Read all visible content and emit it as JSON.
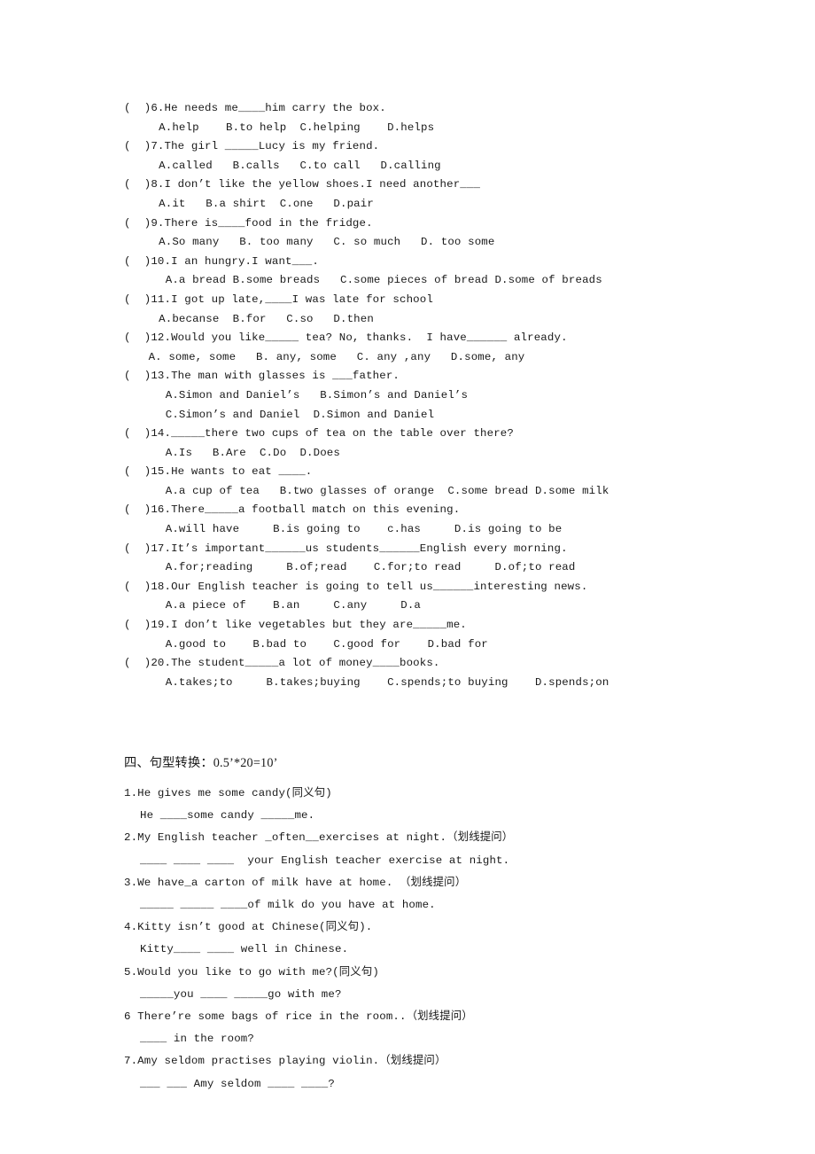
{
  "document": {
    "title": "English Grammar Worksheet",
    "background_color": "#ffffff",
    "text_color": "#191919"
  },
  "multiple_choice": {
    "questions": [
      {
        "stem": "(  )6.He needs me____him carry the box.",
        "options": "  A.help    B.to help  C.helping    D.helps",
        "options_indent": "opt"
      },
      {
        "stem": "(  )7.The girl _____Lucy is my friend.",
        "options": "  A.called   B.calls   C.to call   D.calling",
        "options_indent": "opt"
      },
      {
        "stem": "(  )8.I don’t like the yellow shoes.I need another___",
        "options": "  A.it   B.a shirt  C.one   D.pair",
        "options_indent": "opt"
      },
      {
        "stem": "(  )9.There is____food in the fridge.",
        "options": "  A.So many   B. too many   C. so much   D. too some",
        "options_indent": "opt"
      },
      {
        "stem": "(  )10.I an hungry.I want___.",
        "options": "   A.a bread B.some breads   C.some pieces of bread D.some of breads",
        "options_indent": "opt"
      },
      {
        "stem": "(  )11.I got up late,____I was late for school",
        "options": "  A.becanse  B.for   C.so   D.then",
        "options_indent": "opt"
      },
      {
        "stem": "(  )12.Would you like_____ tea? No, thanks.  I have______ already.",
        "options": " A. some, some   B. any, some   C. any ,any   D.some, any",
        "options_indent": "opt-tight"
      },
      {
        "stem": "(  )13.The man with glasses is ___father.",
        "options": "   A.Simon and Daniel’s   B.Simon’s and Daniel’s",
        "options_indent": "opt",
        "options2": "   C.Simon’s and Daniel  D.Simon and Daniel"
      },
      {
        "stem": "(  )14._____there two cups of tea on the table over there?",
        "options": "   A.Is   B.Are  C.Do  D.Does",
        "options_indent": "opt"
      },
      {
        "stem": "(  )15.He wants to eat ____.",
        "options": "   A.a cup of tea   B.two glasses of orange  C.some bread D.some milk",
        "options_indent": "opt"
      },
      {
        "stem": "(  )16.There_____a football match on this evening.",
        "options": "   A.will have     B.is going to    c.has     D.is going to be",
        "options_indent": "opt"
      },
      {
        "stem": "(  )17.It’s important______us students______English every morning.",
        "options": "   A.for;reading     B.of;read    C.for;to read     D.of;to read",
        "options_indent": "opt"
      },
      {
        "stem": "(  )18.Our English teacher is going to tell us______interesting news.",
        "options": "   A.a piece of    B.an     C.any     D.a",
        "options_indent": "opt"
      },
      {
        "stem": "(  )19.I don’t like vegetables but they are_____me.",
        "options": "   A.good to    B.bad to    C.good for    D.bad for",
        "options_indent": "opt"
      },
      {
        "stem": "(  )20.The student_____a lot of money____books.",
        "options": "   A.takes;to     B.takes;buying    C.spends;to buying    D.spends;on",
        "options_indent": "opt"
      }
    ]
  },
  "section_four": {
    "heading": "四、句型转换：0.5’*20=10’",
    "items": [
      {
        "stem": "1.He gives me some candy(同义句)",
        "answer": "He ____some candy _____me."
      },
      {
        "stem": "2.My English teacher _often__exercises at night.（划线提问）",
        "answer": "____ ____ ____  your English teacher exercise at night."
      },
      {
        "stem": "3.We have_a carton of milk have at home. （划线提问）",
        "answer": "_____ _____ ____of milk do you have at home."
      },
      {
        "stem": "4.Kitty isn’t good at Chinese(同义句).",
        "answer": "Kitty____ ____ well in Chinese."
      },
      {
        "stem": "5.Would you like to go with me?(同义句)",
        "answer": "_____you ____ _____go with me?"
      },
      {
        "stem": "6 There’re some bags of rice in the room..（划线提问）",
        "answer": "____ in the room?"
      },
      {
        "stem": "7.Amy seldom practises playing violin.（划线提问）",
        "answer": "___ ___ Amy seldom ____ ____?"
      }
    ]
  }
}
